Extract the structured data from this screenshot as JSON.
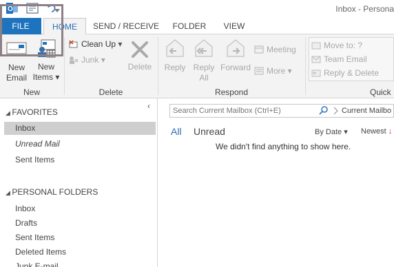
{
  "window": {
    "title": "Inbox - Persona"
  },
  "quick_access": {
    "outlook_icon": "outlook-icon",
    "send_receive_icon": "send-receive-all-icon",
    "undo_icon": "undo-icon",
    "dropdown_icon": "customize-quick-access-icon"
  },
  "tabs": [
    {
      "label": "FILE"
    },
    {
      "label": "HOME"
    },
    {
      "label": "SEND / RECEIVE"
    },
    {
      "label": "FOLDER"
    },
    {
      "label": "VIEW"
    }
  ],
  "ribbon": {
    "new_group": {
      "label": "New",
      "new_email": [
        "New",
        "Email"
      ],
      "new_items": [
        "New",
        "Items"
      ]
    },
    "delete_group": {
      "label": "Delete",
      "clean_up": "Clean Up",
      "junk": "Junk",
      "delete": "Delete"
    },
    "respond_group": {
      "label": "Respond",
      "reply": "Reply",
      "reply_all": [
        "Reply",
        "All"
      ],
      "forward": "Forward",
      "meeting": "Meeting",
      "more": "More"
    },
    "quick_steps_group": {
      "label": "Quick",
      "items": [
        "Move to: ?",
        "Team Email",
        "Reply & Delete"
      ]
    }
  },
  "nav": {
    "collapse_icon": "collapse-pane-icon",
    "favorites": {
      "header": "FAVORITES",
      "items": [
        "Inbox",
        "Unread Mail",
        "Sent Items"
      ]
    },
    "personal": {
      "header": "PERSONAL FOLDERS",
      "items": [
        "Inbox",
        "Drafts",
        "Sent Items",
        "Deleted Items",
        "Junk E-mail"
      ]
    }
  },
  "mail": {
    "search_placeholder": "Search Current Mailbox (Ctrl+E)",
    "scope": "Current Mailbo",
    "filter_all": "All",
    "filter_unread": "Unread",
    "sort_by": "By Date",
    "sort_order": "Newest",
    "empty_message": "We didn't find anything to show here."
  },
  "colors": {
    "accent": "#1e73be",
    "file_tab": "#1e73be",
    "highlight_border": "#8c7f86"
  }
}
